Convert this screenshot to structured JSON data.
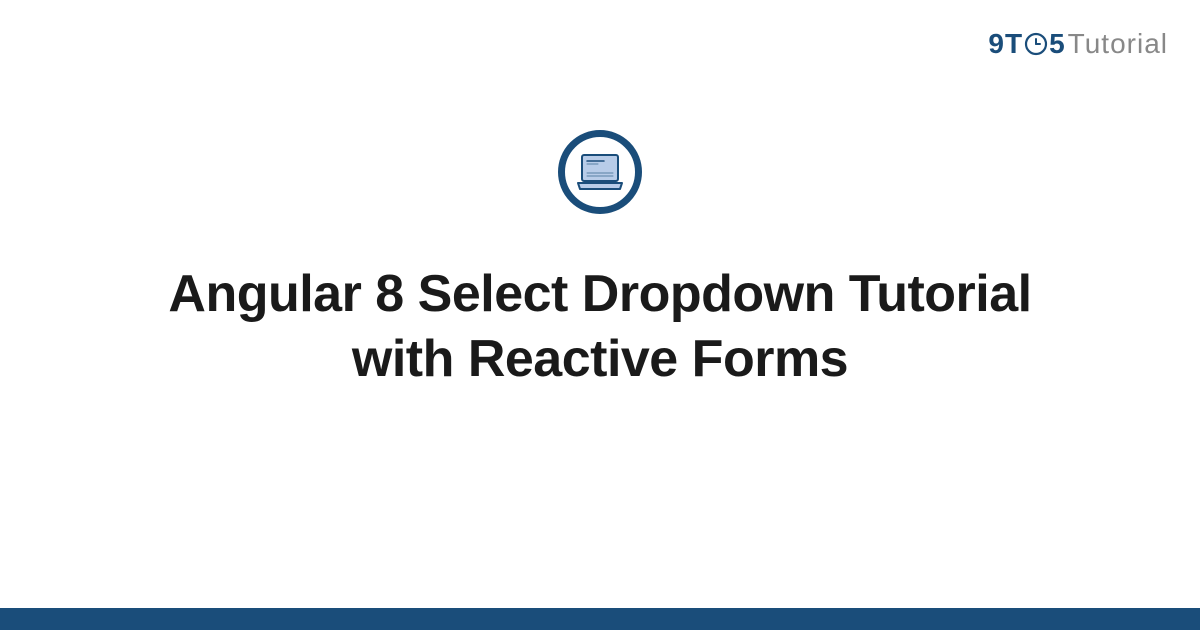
{
  "logo": {
    "part1": "9T",
    "part2": "5",
    "part3": "Tutorial"
  },
  "title": "Angular 8 Select Dropdown Tutorial with Reactive Forms",
  "colors": {
    "brand": "#1a4d7a",
    "muted": "#888888",
    "laptop_fill": "#b8cce8"
  }
}
